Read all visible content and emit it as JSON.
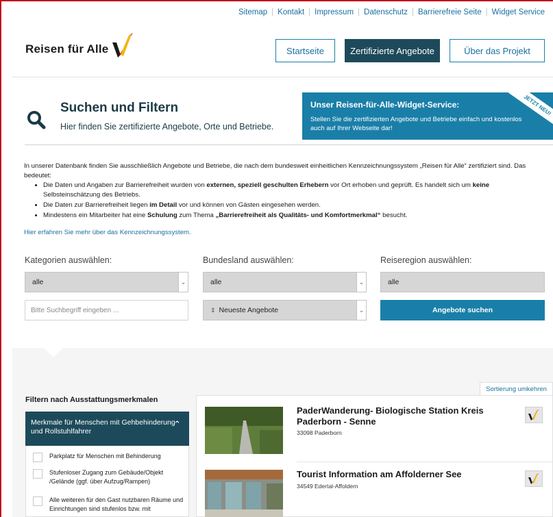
{
  "top_links": [
    "Sitemap",
    "Kontakt",
    "Impressum",
    "Datenschutz",
    "Barrierefreie Seite",
    "Widget Service"
  ],
  "logo_text": "Reisen für Alle",
  "nav": {
    "home": "Startseite",
    "certified": "Zertifizierte Angebote",
    "about": "Über das Projekt"
  },
  "search_header": {
    "title": "Suchen und Filtern",
    "subtitle": "Hier finden Sie zertifizierte Angebote, Orte und Betriebe."
  },
  "widget": {
    "title": "Unser Reisen-für-Alle-Widget-Service:",
    "text": "Stellen Sie die zertifizierten Angebote und Betriebe einfach und kostenlos auch auf Ihrer Webseite dar!",
    "ribbon": "JETZT NEU!"
  },
  "info": {
    "intro": "In unserer Datenbank finden Sie ausschließlich Angebote und Betriebe, die nach dem bundesweit einheitlichen Kennzeichnungssystem „Reisen für Alle“ zertifiziert sind. Das bedeutet:",
    "bullet1_a": "Die Daten und Angaben zur Barrierefreiheit wurden von ",
    "bullet1_b": "externen, speziell geschulten Erhebern",
    "bullet1_c": " vor Ort erhoben und geprüft. Es handelt sich um ",
    "bullet1_d": "keine",
    "bullet1_e": " Selbsteinschätzung des Betriebs.",
    "bullet2_a": "Die Daten zur Barrierefreiheit liegen ",
    "bullet2_b": "im Detail",
    "bullet2_c": " vor und können von Gästen eingesehen werden.",
    "bullet3_a": "Mindestens ein Mitarbeiter hat eine ",
    "bullet3_b": "Schulung",
    "bullet3_c": " zum Thema ",
    "bullet3_d": "„Barrierefreiheit als Qualitäts- und Komfortmerkmal“",
    "bullet3_e": " besucht.",
    "link": "Hier erfahren Sie mehr über das Kennzeichnungssystem."
  },
  "filters": {
    "category_label": "Kategorien auswählen:",
    "category_value": "alle",
    "state_label": "Bundesland auswählen:",
    "state_value": "alle",
    "region_label": "Reiseregion auswählen:",
    "region_value": "alle",
    "search_placeholder": "Bitte Suchbegriff eingeben ...",
    "sort_value": "Neueste Angebote",
    "search_button": "Angebote suchen"
  },
  "sort_reverse": "Sortierung umkehren",
  "features": {
    "title": "Filtern nach Ausstattungsmerkmalen",
    "panel_title": "Merkmale für Menschen mit Gehbehinderung und Rollstuhlfahrer",
    "items": [
      "Parkplatz für Menschen mit Behinderung",
      "Stufenloser Zugang zum Gebäude/Objekt /Gelände (ggf. über Aufzug/Rampen)",
      "Alle weiteren für den Gast nutzbaren Räume und Einrichtungen sind stufenlos bzw. mit"
    ]
  },
  "results": [
    {
      "title": "PaderWanderung- Biologische Station Kreis Paderborn - Senne",
      "location": "33098 Paderborn"
    },
    {
      "title": "Tourist Information am Affolderner See",
      "location": "34549 Edertal-Affoldern"
    }
  ],
  "colors": {
    "primary": "#1a7fa8",
    "dark": "#1d4a5a",
    "frame": "#c0111e"
  }
}
